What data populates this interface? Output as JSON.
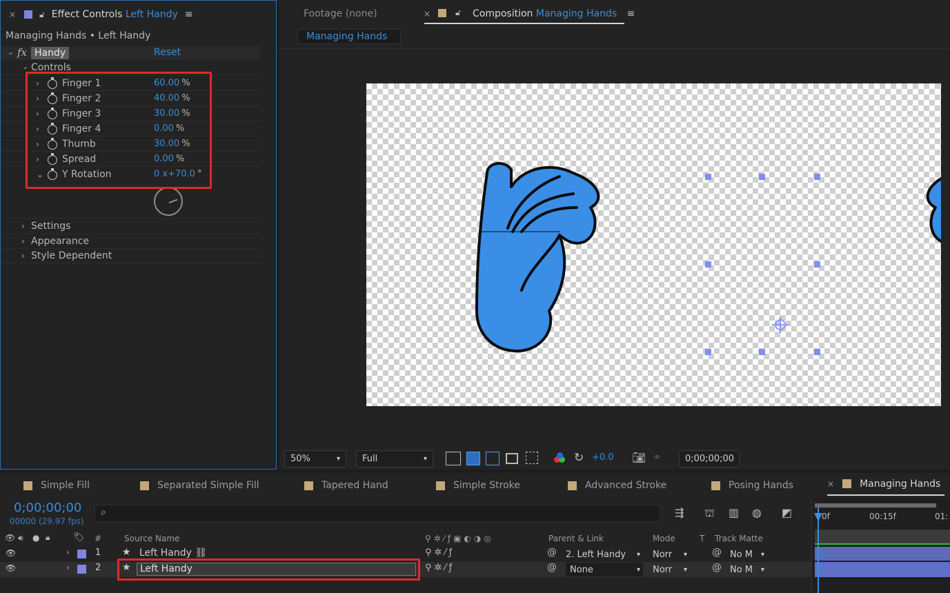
{
  "effect_controls": {
    "tab_close": "×",
    "tab_title": "Effect Controls",
    "tab_layer": "Left Handy",
    "breadcrumb": "Managing Hands • Left Handy",
    "fx_label": "fx",
    "effect_name": "Handy",
    "reset_label": "Reset",
    "controls_group": "Controls",
    "params": [
      {
        "name": "Finger 1",
        "value": "60.00",
        "unit": "%"
      },
      {
        "name": "Finger 2",
        "value": "40.00",
        "unit": "%"
      },
      {
        "name": "Finger 3",
        "value": "30.00",
        "unit": "%"
      },
      {
        "name": "Finger 4",
        "value": "0.00",
        "unit": "%"
      },
      {
        "name": "Thumb",
        "value": "30.00",
        "unit": "%"
      },
      {
        "name": "Spread",
        "value": "0.00",
        "unit": "%"
      },
      {
        "name": "Y Rotation",
        "value": "0 x+70.0",
        "unit": "°"
      }
    ],
    "groups": [
      "Settings",
      "Appearance",
      "Style Dependent"
    ]
  },
  "viewer": {
    "footage_tab": "Footage (none)",
    "comp_tab_prefix": "Composition",
    "comp_tab_name": "Managing Hands",
    "comp_subtab": "Managing Hands",
    "zoom": "50%",
    "resolution": "Full",
    "exposure": "+0.0",
    "timecode": "0;00;00;00",
    "hand_color": "#3a8ee6"
  },
  "bottom_tabs": [
    {
      "label": "Simple Fill"
    },
    {
      "label": "Separated Simple Fill"
    },
    {
      "label": "Tapered Hand"
    },
    {
      "label": "Simple Stroke"
    },
    {
      "label": "Advanced Stroke"
    },
    {
      "label": "Posing Hands"
    },
    {
      "label": "Managing Hands"
    }
  ],
  "timeline": {
    "current_time": "0;00;00;00",
    "frames": "00000 (29.97 fps)",
    "search_placeholder": "",
    "columns": {
      "hash": "#",
      "source_name": "Source Name",
      "parent": "Parent & Link",
      "mode": "Mode",
      "t": "T",
      "track_matte": "Track Matte"
    },
    "ruler": [
      "0f",
      "00:15f",
      "01:"
    ],
    "layers": [
      {
        "num": "1",
        "name": "Left Handy ⛓",
        "parent": "2. Left Handy",
        "mode": "Norr",
        "matte": "No M"
      },
      {
        "num": "2",
        "name": "Left Handy",
        "parent": "None",
        "mode": "Norr",
        "matte": "No M"
      }
    ]
  }
}
